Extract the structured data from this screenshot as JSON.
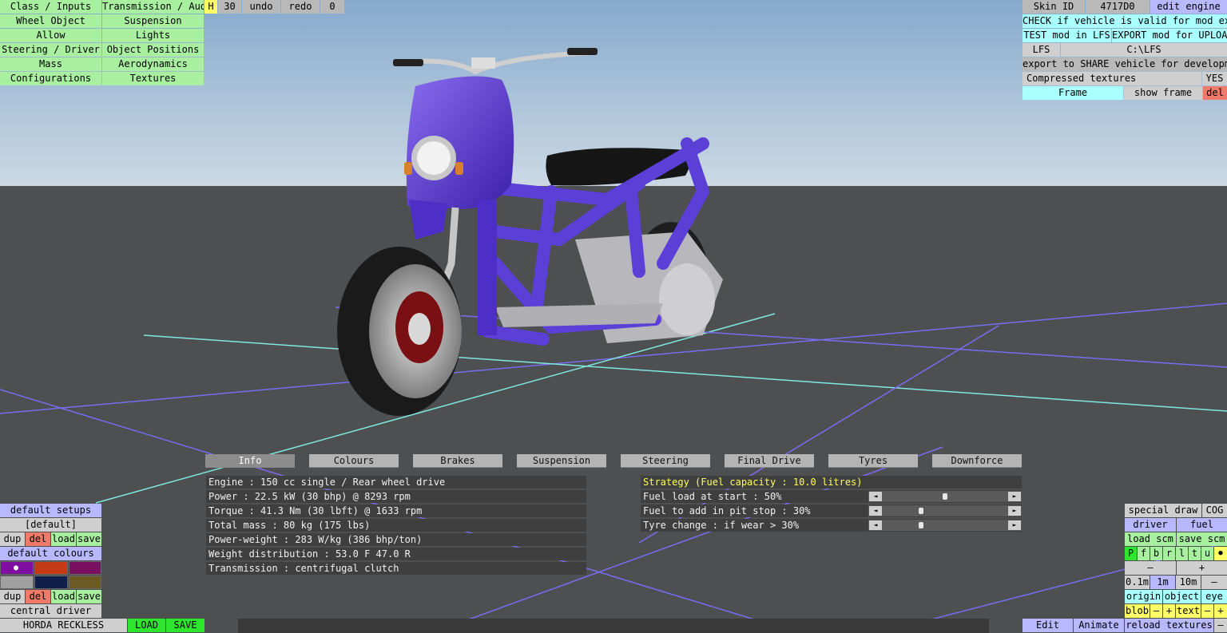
{
  "top_left_menu": {
    "col1": [
      "Class / Inputs",
      "Wheel Object",
      "Allow",
      "Steering / Driver",
      "Mass",
      "Configurations"
    ],
    "col2": [
      "Transmission / Audio",
      "Suspension",
      "Lights",
      "Object Positions",
      "Aerodynamics",
      "Textures"
    ],
    "h_label": "H",
    "step_value": "30",
    "undo_label": "undo",
    "redo_label": "redo",
    "counter_value": "0"
  },
  "top_right": {
    "skin_id_label": "Skin ID",
    "skin_id_value": "4717D0",
    "edit_engine_label": "edit engine",
    "check_label": "CHECK if vehicle is valid for mod export",
    "test_label": "TEST mod in LFS",
    "export_label": "EXPORT mod for UPLOAD",
    "lfs_label": "LFS",
    "lfs_path": "C:\\LFS",
    "share_label": "export to SHARE vehicle for development",
    "compressed_label": "Compressed textures",
    "compressed_value": "YES",
    "frame_label": "Frame",
    "show_frame_label": "show frame",
    "del_label": "del"
  },
  "tabs": [
    "Info",
    "Colours",
    "Brakes",
    "Suspension",
    "Steering",
    "Final Drive",
    "Tyres",
    "Downforce"
  ],
  "active_tab": "Info",
  "info_rows": [
    "Engine : 150 cc single / Rear wheel drive",
    "Power : 22.5 kW (30 bhp) @ 8293 rpm",
    "Torque : 41.3 Nm (30 lbft) @ 1633 rpm",
    "Total mass : 80 kg (175 lbs)",
    "Power-weight : 283 W/kg (386 bhp/ton)",
    "Weight distribution : 53.0 F  47.0 R",
    "Transmission : centrifugal clutch"
  ],
  "strategy": {
    "title": "Strategy (Fuel capacity : 10.0 litres)",
    "rows": [
      {
        "label": "Fuel load at start : 50%",
        "level": 0.5
      },
      {
        "label": "Fuel to add in pit stop : 30%",
        "level": 0.3
      },
      {
        "label": "Tyre change : if wear > 30%",
        "level": 0.3
      }
    ],
    "left_arrow": "◄",
    "right_arrow": "►"
  },
  "bottom_left": {
    "default_setups_label": "default setups",
    "default_value": "[default]",
    "dup": "dup",
    "del": "del",
    "load": "load",
    "save": "save",
    "default_colours_label": "default colours",
    "central_driver_label": "central driver",
    "car_name": "HORDA RECKLESS",
    "load_btn": "LOAD",
    "save_btn": "SAVE",
    "swatch_colors": [
      "#7f0fa0",
      "#c43a14",
      "#7a1060",
      "#a0a0a0",
      "#0f1f4a",
      "#6b5a24"
    ]
  },
  "bottom_right": {
    "special_draw": "special draw",
    "cog": "COG",
    "driver": "driver",
    "fuel": "fuel",
    "load_scm": "load scm",
    "save_scm": "save scm",
    "letters": [
      "P",
      "f",
      "b",
      "r",
      "l",
      "t",
      "u"
    ],
    "dot": "●",
    "minus": "–",
    "plus": "+",
    "dist": [
      "0.1m",
      "1m",
      "10m"
    ],
    "origin": "origin",
    "object": "object",
    "eye": "eye",
    "blob": "blob",
    "text": "text",
    "edit": "Edit",
    "animate": "Animate",
    "reload_textures": "reload textures"
  },
  "colors": {
    "sky_top": "#8fb0d0",
    "sky_bottom": "#c9d7e2",
    "ground": "#4e4f51",
    "scooter_body": "#5a3fd0"
  }
}
